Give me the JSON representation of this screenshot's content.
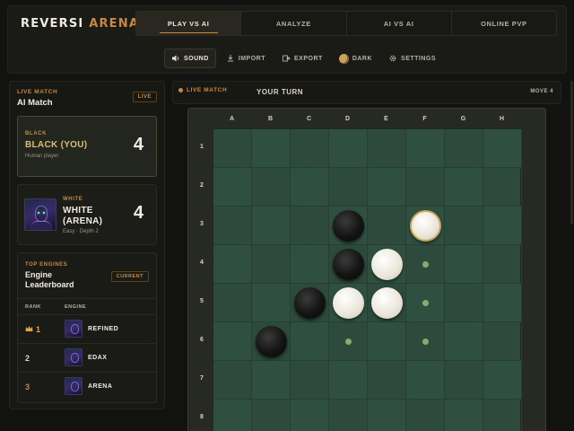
{
  "brand": {
    "part1": "REVERSI",
    "part2": "ARENA"
  },
  "tabs": [
    {
      "label": "PLAY VS AI",
      "active": true
    },
    {
      "label": "ANALYZE",
      "active": false
    },
    {
      "label": "AI VS AI",
      "active": false
    },
    {
      "label": "ONLINE PVP",
      "active": false
    }
  ],
  "toolbar": {
    "sound": "SOUND",
    "import": "IMPORT",
    "export": "EXPORT",
    "dark": "DARK",
    "settings": "SETTINGS"
  },
  "left": {
    "live_label": "LIVE MATCH",
    "title": "AI Match",
    "badge": "LIVE",
    "black": {
      "label": "BLACK",
      "name": "BLACK (YOU)",
      "sub": "Human player",
      "score": "4"
    },
    "white": {
      "label": "WHITE",
      "name": "WHITE (ARENA)",
      "sub": "Easy · Depth 2",
      "score": "4"
    },
    "leaderboard": {
      "label": "TOP ENGINES",
      "title": "Engine Leaderboard",
      "badge": "CURRENT",
      "col_rank": "RANK",
      "col_engine": "ENGINE",
      "rows": [
        {
          "rank": "1",
          "name": "REFINED"
        },
        {
          "rank": "2",
          "name": "EDAX"
        },
        {
          "rank": "3",
          "name": "ARENA"
        }
      ]
    }
  },
  "game": {
    "status": "LIVE MATCH",
    "turn": "YOUR TURN",
    "move": "MOVE 4",
    "columns": [
      "A",
      "B",
      "C",
      "D",
      "E",
      "F",
      "G",
      "H"
    ],
    "rows": [
      "1",
      "2",
      "3",
      "4",
      "5",
      "6",
      "7",
      "8"
    ],
    "board": [
      "........",
      "........",
      "...B.W..",
      "...BWh..",
      "..BWWh..",
      ".B.h.h..",
      "........",
      "........"
    ],
    "last_move": "F3",
    "colors": {
      "accent": "#c8893f",
      "board": "#2d4a3c",
      "hint": "#8fa86a"
    }
  }
}
